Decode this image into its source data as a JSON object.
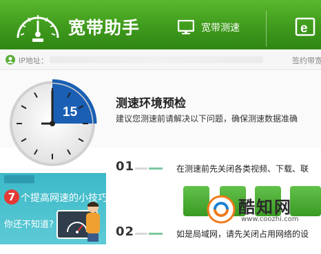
{
  "header": {
    "app_title": "宽带助手",
    "nav_speed_label": "宽带测速"
  },
  "ip_bar": {
    "ip_label": "IP地址：",
    "contract_label": "签约带宽"
  },
  "precheck": {
    "timer_value": "15",
    "title": "测速环境预检",
    "description": "建议您测速前请解决以下问题，确保测速数据准确"
  },
  "sidebar_promo": {
    "number": "7",
    "headline": "个提高网速的小技巧",
    "subtitle": "你还不知道?"
  },
  "steps": [
    {
      "number": "01",
      "text": "在测速前先关闭各类视频、下载、联"
    },
    {
      "number": "02",
      "text": "如是局域网，请先关闭占用网络的设"
    }
  ],
  "watermark": {
    "name": "酷知网",
    "url": "www.coozhi.com"
  },
  "colors": {
    "header_green": "#3f9a1c",
    "timer_blue": "#1a5fb4",
    "accent_green": "#5cae3a"
  }
}
